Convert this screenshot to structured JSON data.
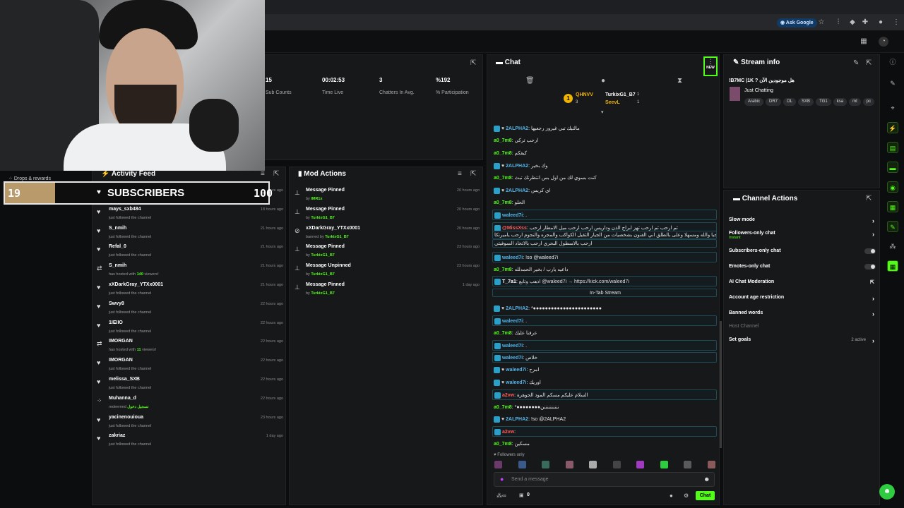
{
  "browser": {
    "ask_google": "Ask Google"
  },
  "stats": [
    {
      "value": "15",
      "label": "Sub Counts"
    },
    {
      "value": "00:02:53",
      "label": "Time Live"
    },
    {
      "value": "3",
      "label": "Chatters In Avg."
    },
    {
      "value": "%192",
      "label": "% Participation"
    }
  ],
  "drops": {
    "label": "Drops & rewards"
  },
  "subgoal": {
    "current": "19",
    "label": "SUBSCRIBERS",
    "target": "100",
    "progress": 0.19
  },
  "activity": {
    "title": "Activity Feed",
    "items": [
      {
        "name": "",
        "sub": "just followed the channel",
        "time": "15 hours ago",
        "icon": "heart"
      },
      {
        "name": "mays_sxb484",
        "sub": "just followed the channel",
        "time": "18 hours ago",
        "icon": "heart"
      },
      {
        "name": "S_nmih",
        "sub": "just followed the channel",
        "time": "21 hours ago",
        "icon": "heart"
      },
      {
        "name": "Refal_0",
        "sub": "just followed the channel",
        "time": "21 hours ago",
        "icon": "heart"
      },
      {
        "name": "S_nmih",
        "sub_pre": "has hosted with ",
        "sub_num": "140",
        "sub_post": " viewers!",
        "time": "21 hours ago",
        "icon": "host"
      },
      {
        "name": "xXDarkGray_YTXx0001",
        "sub": "just followed the channel",
        "time": "21 hours ago",
        "icon": "heart"
      },
      {
        "name": "Swvy8",
        "sub": "just followed the channel",
        "time": "22 hours ago",
        "icon": "heart"
      },
      {
        "name": "1IEIIO",
        "sub": "just followed the channel",
        "time": "22 hours ago",
        "icon": "heart"
      },
      {
        "name": "IMORGAN",
        "sub_pre": "has hosted with ",
        "sub_num": "11",
        "sub_post": " viewers!",
        "time": "22 hours ago",
        "icon": "host"
      },
      {
        "name": "IMORGAN",
        "sub": "just followed the channel",
        "time": "22 hours ago",
        "icon": "heart"
      },
      {
        "name": "melissa_SXB",
        "sub": "just followed the channel",
        "time": "22 hours ago",
        "icon": "heart"
      },
      {
        "name": "Muhanna_d",
        "sub_pre": "redeemed ",
        "sub_num": "تسجيل دخول",
        "sub_post": "",
        "time": "22 hours ago",
        "icon": "redeem"
      },
      {
        "name": "yacinenouioua",
        "sub": "just followed the channel",
        "time": "23 hours ago",
        "icon": "heart"
      },
      {
        "name": "zakriaz",
        "sub": "just followed the channel",
        "time": "1 day ago",
        "icon": "heart"
      }
    ]
  },
  "mod": {
    "title": "Mod Actions",
    "items": [
      {
        "action": "Message Pinned",
        "by_pre": "by ",
        "by": "IMR1x",
        "time": "20 hours ago",
        "icon": "pin"
      },
      {
        "action": "Message Pinned",
        "by_pre": "by ",
        "by": "TurkixG1_B7",
        "time": "20 hours ago",
        "icon": "pin"
      },
      {
        "action": "xXDarkGray_YTXx0001",
        "by_pre": "banned by ",
        "by": "TurkixG1_B7",
        "time": "20 hours ago",
        "icon": "ban"
      },
      {
        "action": "Message Pinned",
        "by_pre": "by ",
        "by": "TurkixG1_B7",
        "time": "23 hours ago",
        "icon": "pin"
      },
      {
        "action": "Message Unpinned",
        "by_pre": "by ",
        "by": "TurkixG1_B7",
        "time": "23 hours ago",
        "icon": "unpin"
      },
      {
        "action": "Message Pinned",
        "by_pre": "by ",
        "by": "TurkixG1_B7",
        "time": "1 day ago",
        "icon": "pin"
      }
    ]
  },
  "chat": {
    "title": "Chat",
    "new_label": "NEW",
    "leaders": [
      {
        "name": "QHNVV",
        "count": "3"
      },
      {
        "name": "TurkixG1_B7",
        "count": "1"
      },
      {
        "name": "SeevL",
        "count": "1"
      }
    ],
    "messages": [
      {
        "user": "2ALPHA2",
        "text": "مالتيك تبي غيروز رجعيها",
        "color": "cyan",
        "hl": false
      },
      {
        "user": "a0_7m8",
        "text": "ارحب تركي",
        "color": "green",
        "hl": false
      },
      {
        "user": "a0_7m8",
        "text": "كيفكم",
        "color": "green",
        "hl": false
      },
      {
        "user": "2ALPHA2",
        "text": "وك بخير",
        "color": "cyan",
        "hl": false
      },
      {
        "user": "a0_7m8",
        "text": "كنت بسوي لك من اول بس انتظرتك تبث",
        "color": "green",
        "hl": false
      },
      {
        "user": "2ALPHA2",
        "text": "اي كريس",
        "color": "cyan",
        "hl": false
      },
      {
        "user": "a0_7m8",
        "text": "الحلو",
        "color": "green",
        "hl": false
      },
      {
        "user": "waleed7i",
        "text": ".",
        "color": "cyan",
        "hl": true
      },
      {
        "user": "@MissXss",
        "text": "ثم ارحب ثم ارحب تهز ابراج الذن وداريس ارحب ارحب ميل الامطار ارحب",
        "color": "red",
        "hl": true
      },
      {
        "user": "",
        "text": "ومرحبا والله ومسهلا وعلى بالطلق اني الفنون بشخصيات من الجيار الثقيل الكواكب والمجره والنجوم ارحب ياميرتكا",
        "color": "",
        "hl": true
      },
      {
        "user": "",
        "text": "ارحب بالاسطول البحري ارحب بالاتحاد السوفيتي",
        "color": "",
        "hl": true
      },
      {
        "user": "waleed7i",
        "text": "!so @waleed7i",
        "color": "cyan",
        "hl": true
      },
      {
        "user": "a0_7m8",
        "text": "داعيه يارب / بخير الحمدلله",
        "color": "green",
        "hl": false
      },
      {
        "user": "T_7a1",
        "text": "اذهب وتابع @waleed7i → https://kick.com/waleed7i",
        "color": "white",
        "hl": true
      },
      {
        "user": "",
        "text": "In-Tab Stream",
        "color": "",
        "hl": true
      },
      {
        "user": "2ALPHA2",
        "text": "*●●●●●●●●●●●●●●●●●●●●●●●",
        "color": "cyan",
        "hl": false
      },
      {
        "user": "waleed7i",
        "text": ".",
        "color": "cyan",
        "hl": true
      },
      {
        "user": "a0_7m8",
        "text": "عرفنا عليك",
        "color": "green",
        "hl": false
      },
      {
        "user": "waleed7i",
        "text": ".",
        "color": "cyan",
        "hl": true
      },
      {
        "user": "waleed7i",
        "text": "خلاص",
        "color": "cyan",
        "hl": true
      },
      {
        "user": "waleed7i",
        "text": "امزح",
        "color": "cyan",
        "hl": false
      },
      {
        "user": "waleed7i",
        "text": "اوريك",
        "color": "cyan",
        "hl": false
      },
      {
        "user": "a2vw",
        "text": "السلام عليكم مسكم المود الجوهرة",
        "color": "red",
        "hl": true
      },
      {
        "user": "a0_7m8",
        "text": "*●●●●●●●●ننننننننننن",
        "color": "green",
        "hl": false
      },
      {
        "user": "2ALPHA2",
        "text": "!so @2ALPHA2",
        "color": "cyan",
        "hl": false
      },
      {
        "user": "a2vw",
        "text": "",
        "color": "red",
        "hl": true
      },
      {
        "user": "a0_7m8",
        "text": "مسكين",
        "color": "green",
        "hl": false
      }
    ],
    "followers_only": "Followers only",
    "input_placeholder": "Send a message",
    "viewer_count": "0",
    "chat_button": "Chat"
  },
  "stream_info": {
    "title": "Stream info",
    "stream_title": "!B7MC |1K ? هل موجودين الآن",
    "category": "Just Chatting",
    "tags": [
      "Arabic",
      "DR7",
      "OL",
      "SXB",
      "TG1",
      "ksa",
      "mt",
      "pc"
    ]
  },
  "channel_actions": {
    "title": "Channel Actions",
    "items": [
      {
        "label": "Slow mode",
        "sub": "",
        "control": "chevron",
        "extra": ""
      },
      {
        "label": "Followers-only chat",
        "sub": "Instant",
        "control": "chevron",
        "extra": ""
      },
      {
        "label": "Subscribers-only chat",
        "sub": "",
        "control": "toggle",
        "extra": ""
      },
      {
        "label": "Emotes-only chat",
        "sub": "",
        "control": "toggle",
        "extra": ""
      },
      {
        "label": "AI Chat Moderation",
        "sub": "",
        "control": "external",
        "extra": ""
      },
      {
        "label": "Account age restriction",
        "sub": "",
        "control": "chevron",
        "extra": ""
      },
      {
        "label": "Banned words",
        "sub": "",
        "control": "chevron",
        "extra": ""
      },
      {
        "label": "Host Channel",
        "sub": "",
        "control": "none",
        "extra": ""
      },
      {
        "label": "Set goals",
        "sub": "",
        "control": "chevron",
        "extra": "2 active"
      }
    ]
  },
  "colors": {
    "accent": "#53fc18",
    "panel": "#17181a",
    "bg": "#0c0d0e",
    "gold": "#b99a6a"
  }
}
